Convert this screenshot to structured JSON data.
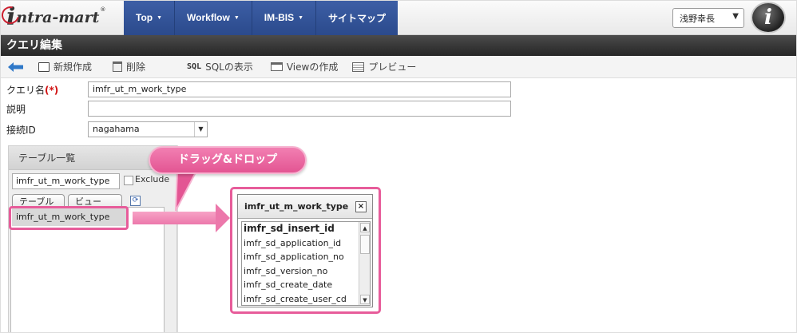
{
  "header": {
    "logo_text": "ntra-mart",
    "nav": [
      {
        "label": "Top",
        "caret": "▼"
      },
      {
        "label": "Workflow",
        "caret": "▼"
      },
      {
        "label": "IM-BIS",
        "caret": "▼"
      },
      {
        "label": "サイトマップ",
        "caret": ""
      }
    ],
    "user_name": "浅野幸長",
    "user_caret": "▼",
    "brand_color": "#2f4f8f",
    "accent_color": "#e75c9a"
  },
  "page_title": "クエリ編集",
  "toolbar": {
    "new_label": "新規作成",
    "delete_label": "削除",
    "sql_icon": "SQL",
    "sql_label": "SQLの表示",
    "view_label": "Viewの作成",
    "preview_label": "プレビュー"
  },
  "form": {
    "query_name_label": "クエリ名",
    "required_mark": "(*)",
    "query_name_value": "imfr_ut_m_work_type",
    "description_label": "説明",
    "description_value": "",
    "connection_label": "接続ID",
    "connection_value": "nagahama"
  },
  "table_list": {
    "title": "テーブル一覧",
    "search_value": "imfr_ut_m_work_type",
    "exclude_label": "Exclude",
    "tab_table": "テーブル",
    "tab_view": "ビュー",
    "items": [
      "imfr_ut_m_work_type"
    ]
  },
  "callout": {
    "text": "ドラッグ&ドロップ"
  },
  "table_box": {
    "title": "imfr_ut_m_work_type",
    "close": "×",
    "columns": [
      "imfr_sd_insert_id",
      "imfr_sd_application_id",
      "imfr_sd_application_no",
      "imfr_sd_version_no",
      "imfr_sd_create_date",
      "imfr_sd_create_user_cd"
    ]
  }
}
